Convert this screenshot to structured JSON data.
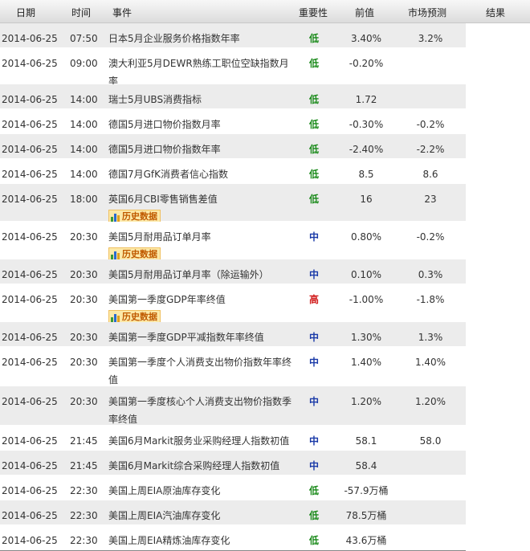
{
  "header": {
    "date": "日期",
    "time": "时间",
    "event": "事件",
    "importance": "重要性",
    "previous": "前值",
    "forecast": "市场预测",
    "actual": "结果"
  },
  "history_label": "历史数据",
  "colors": {
    "low": "#1a8a1a",
    "mid": "#1a3aa8",
    "high": "#d11a1a",
    "row_alt": "#ececec"
  },
  "rows": [
    {
      "date": "2014-06-25",
      "time": "07:50",
      "event_lines": [
        "日本5月企业服务价格指数年率"
      ],
      "importance": "低",
      "level": "low",
      "previous": "3.40%",
      "forecast": "3.2%",
      "history": false
    },
    {
      "date": "2014-06-25",
      "time": "09:00",
      "event_lines": [
        "澳大利亚5月DEWR熟练工职位空缺指数月",
        "率"
      ],
      "importance": "低",
      "level": "low",
      "previous": "-0.20%",
      "forecast": "",
      "history": false
    },
    {
      "date": "2014-06-25",
      "time": "14:00",
      "event_lines": [
        "瑞士5月UBS消费指标"
      ],
      "importance": "低",
      "level": "low",
      "previous": "1.72",
      "forecast": "",
      "history": false
    },
    {
      "date": "2014-06-25",
      "time": "14:00",
      "event_lines": [
        "德国5月进口物价指数月率"
      ],
      "importance": "低",
      "level": "low",
      "previous": "-0.30%",
      "forecast": "-0.2%",
      "history": false
    },
    {
      "date": "2014-06-25",
      "time": "14:00",
      "event_lines": [
        "德国5月进口物价指数年率"
      ],
      "importance": "低",
      "level": "low",
      "previous": "-2.40%",
      "forecast": "-2.2%",
      "history": false
    },
    {
      "date": "2014-06-25",
      "time": "14:00",
      "event_lines": [
        "德国7月GfK消费者信心指数"
      ],
      "importance": "低",
      "level": "low",
      "previous": "8.5",
      "forecast": "8.6",
      "history": false
    },
    {
      "date": "2014-06-25",
      "time": "18:00",
      "event_lines": [
        "英国6月CBI零售销售差值"
      ],
      "importance": "低",
      "level": "low",
      "previous": "16",
      "forecast": "23",
      "history": true
    },
    {
      "date": "2014-06-25",
      "time": "20:30",
      "event_lines": [
        "美国5月耐用品订单月率"
      ],
      "importance": "中",
      "level": "mid",
      "previous": "0.80%",
      "forecast": "-0.2%",
      "history": true
    },
    {
      "date": "2014-06-25",
      "time": "20:30",
      "event_lines": [
        "美国5月耐用品订单月率（除运输外）"
      ],
      "importance": "中",
      "level": "mid",
      "previous": "0.10%",
      "forecast": "0.3%",
      "history": false
    },
    {
      "date": "2014-06-25",
      "time": "20:30",
      "event_lines": [
        "美国第一季度GDP年率终值"
      ],
      "importance": "高",
      "level": "high",
      "previous": "-1.00%",
      "forecast": "-1.8%",
      "history": true
    },
    {
      "date": "2014-06-25",
      "time": "20:30",
      "event_lines": [
        "美国第一季度GDP平减指数年率终值"
      ],
      "importance": "中",
      "level": "mid",
      "previous": "1.30%",
      "forecast": "1.3%",
      "history": false
    },
    {
      "date": "2014-06-25",
      "time": "20:30",
      "event_lines": [
        "美国第一季度个人消费支出物价指数年率终",
        "值"
      ],
      "importance": "中",
      "level": "mid",
      "previous": "1.40%",
      "forecast": "1.40%",
      "history": false
    },
    {
      "date": "2014-06-25",
      "time": "20:30",
      "event_lines": [
        "美国第一季度核心个人消费支出物价指数季",
        "率终值"
      ],
      "importance": "中",
      "level": "mid",
      "previous": "1.20%",
      "forecast": "1.20%",
      "history": false
    },
    {
      "date": "2014-06-25",
      "time": "21:45",
      "event_lines": [
        "美国6月Markit服务业采购经理人指数初值"
      ],
      "importance": "中",
      "level": "mid",
      "previous": "58.1",
      "forecast": "58.0",
      "history": false
    },
    {
      "date": "2014-06-25",
      "time": "21:45",
      "event_lines": [
        "美国6月Markit综合采购经理人指数初值"
      ],
      "importance": "中",
      "level": "mid",
      "previous": "58.4",
      "forecast": "",
      "history": false
    },
    {
      "date": "2014-06-25",
      "time": "22:30",
      "event_lines": [
        "美国上周EIA原油库存变化"
      ],
      "importance": "低",
      "level": "low",
      "previous": "-57.9万桶",
      "forecast": "",
      "history": false
    },
    {
      "date": "2014-06-25",
      "time": "22:30",
      "event_lines": [
        "美国上周EIA汽油库存变化"
      ],
      "importance": "低",
      "level": "low",
      "previous": "78.5万桶",
      "forecast": "",
      "history": false
    },
    {
      "date": "2014-06-25",
      "time": "22:30",
      "event_lines": [
        "美国上周EIA精炼油库存变化"
      ],
      "importance": "低",
      "level": "low",
      "previous": "43.6万桶",
      "forecast": "",
      "history": false
    }
  ]
}
